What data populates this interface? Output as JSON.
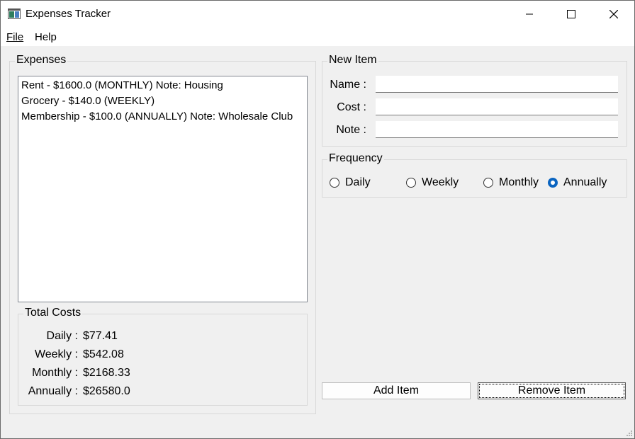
{
  "window": {
    "title": "Expenses Tracker"
  },
  "menu": {
    "file_label": "File",
    "help_label": "Help"
  },
  "expenses": {
    "title": "Expenses",
    "items": [
      "Rent - $1600.0 (MONTHLY) Note: Housing",
      "Grocery - $140.0 (WEEKLY)",
      "Membership - $100.0 (ANNUALLY) Note: Wholesale Club"
    ]
  },
  "totals": {
    "title": "Total Costs",
    "rows": [
      {
        "label": "Daily :",
        "value": "$77.41"
      },
      {
        "label": "Weekly :",
        "value": "$542.08"
      },
      {
        "label": "Monthly :",
        "value": "$2168.33"
      },
      {
        "label": "Annually :",
        "value": "$26580.0"
      }
    ]
  },
  "new_item": {
    "title": "New Item",
    "name_label": "Name :",
    "cost_label": "Cost :",
    "note_label": "Note :",
    "name_value": "",
    "cost_value": "",
    "note_value": ""
  },
  "frequency": {
    "title": "Frequency",
    "options": [
      "Daily",
      "Weekly",
      "Monthly",
      "Annually"
    ],
    "selected": "Annually"
  },
  "buttons": {
    "add": "Add Item",
    "remove": "Remove Item"
  },
  "colors": {
    "accent": "#0a64c0",
    "window_bg": "#f0f0f0"
  }
}
